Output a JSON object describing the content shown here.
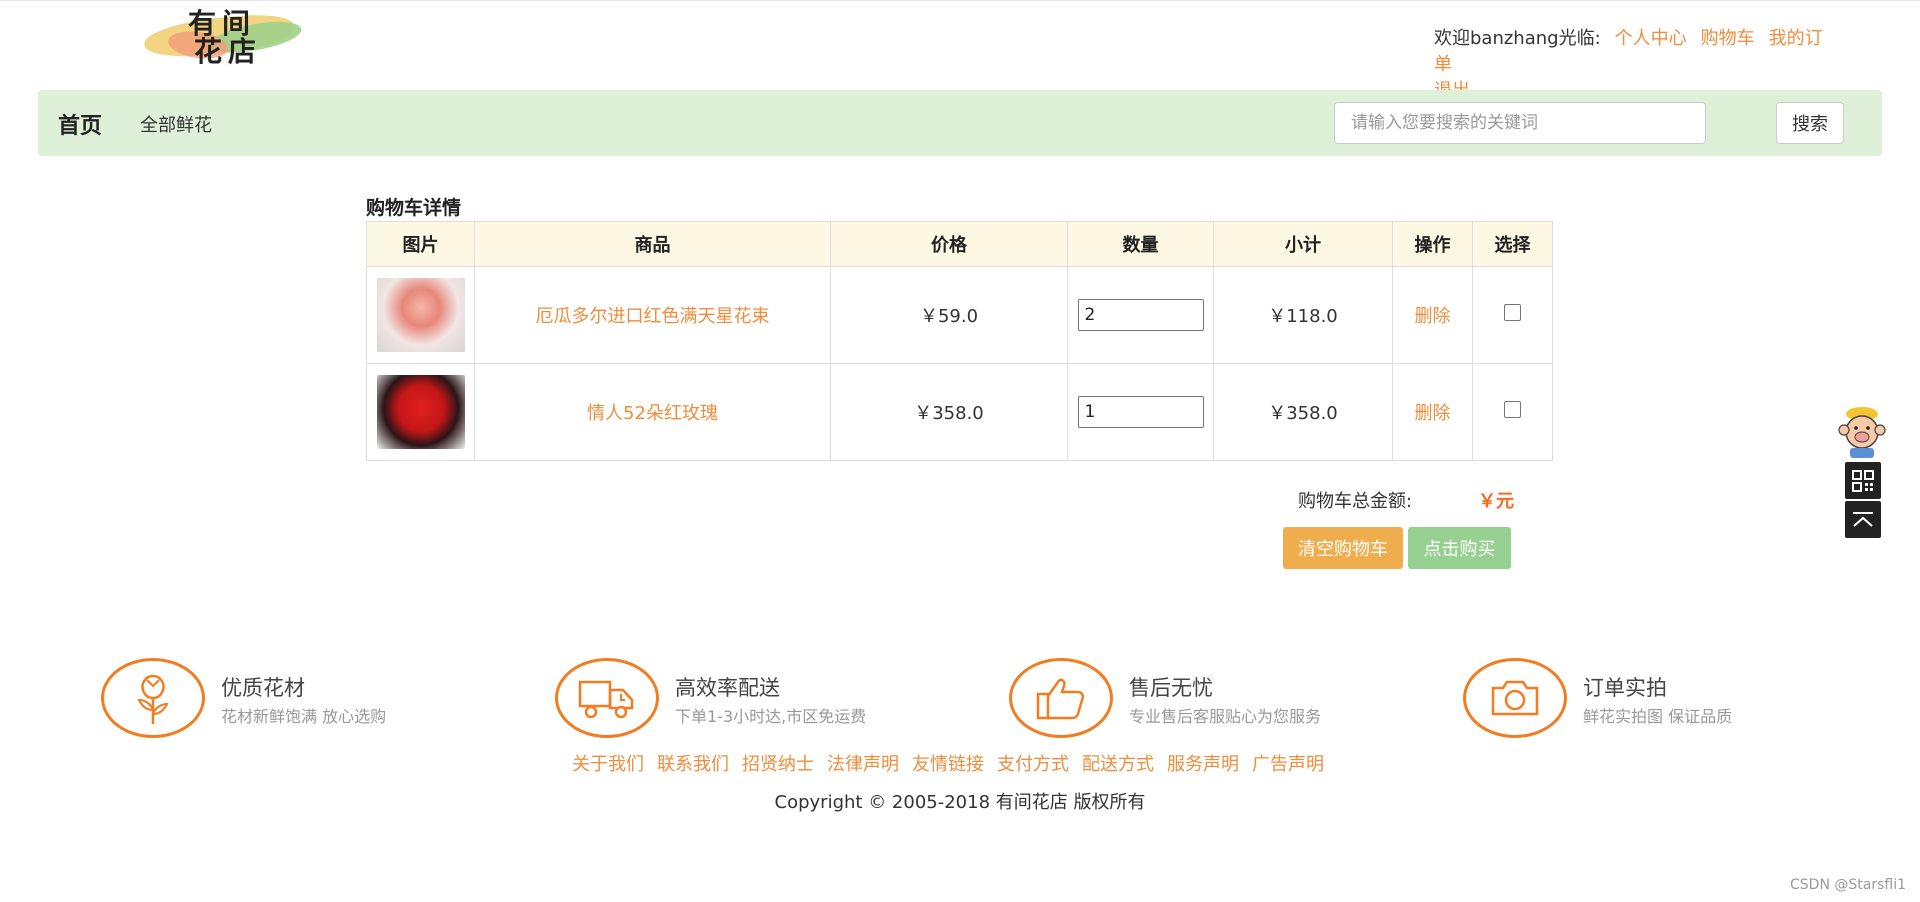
{
  "logo": {
    "line1": "有间",
    "line2": "花店"
  },
  "user": {
    "welcome": "欢迎banzhang光临:",
    "links": [
      "个人中心",
      "购物车",
      "我的订单",
      "退出"
    ]
  },
  "nav": {
    "home": "首页",
    "all_flowers": "全部鲜花",
    "search_placeholder": "请输入您要搜索的关键词",
    "search_button": "搜索"
  },
  "cart": {
    "title": "购物车详情",
    "headers": [
      "图片",
      "商品",
      "价格",
      "数量",
      "小计",
      "操作",
      "选择"
    ],
    "rows": [
      {
        "name": "厄瓜多尔进口红色满天星花束",
        "price": "￥59.0",
        "qty": "2",
        "subtotal": "￥118.0",
        "action": "删除"
      },
      {
        "name": "情人52朵红玫瑰",
        "price": "￥358.0",
        "qty": "1",
        "subtotal": "￥358.0",
        "action": "删除"
      }
    ],
    "total_label": "购物车总金额:",
    "total_value": "￥元",
    "clear_button": "清空购物车",
    "buy_button": "点击购买"
  },
  "features": [
    {
      "title": "优质花材",
      "desc": "花材新鲜饱满 放心选购",
      "icon": "flower-icon"
    },
    {
      "title": "高效率配送",
      "desc": "下单1-3小时达,市区免运费",
      "icon": "truck-icon"
    },
    {
      "title": "售后无忧",
      "desc": "专业售后客服贴心为您服务",
      "icon": "thumbs-up-icon"
    },
    {
      "title": "订单实拍",
      "desc": "鲜花实拍图 保证品质",
      "icon": "camera-icon"
    }
  ],
  "footer": {
    "links": [
      "关于我们",
      "联系我们",
      "招贤纳士",
      "法律声明",
      "友情链接",
      "支付方式",
      "配送方式",
      "服务声明",
      "广告声明"
    ],
    "copyright": "Copyright © 2005-2018 有间花店 版权所有"
  },
  "watermark": "CSDN @Starsfli1",
  "colors": {
    "accent": "#f08d3c",
    "nav_bg": "#dff0d8",
    "header_bg": "#fcf8e3",
    "clear_btn": "#f0ad4e",
    "buy_btn": "#96d192"
  }
}
